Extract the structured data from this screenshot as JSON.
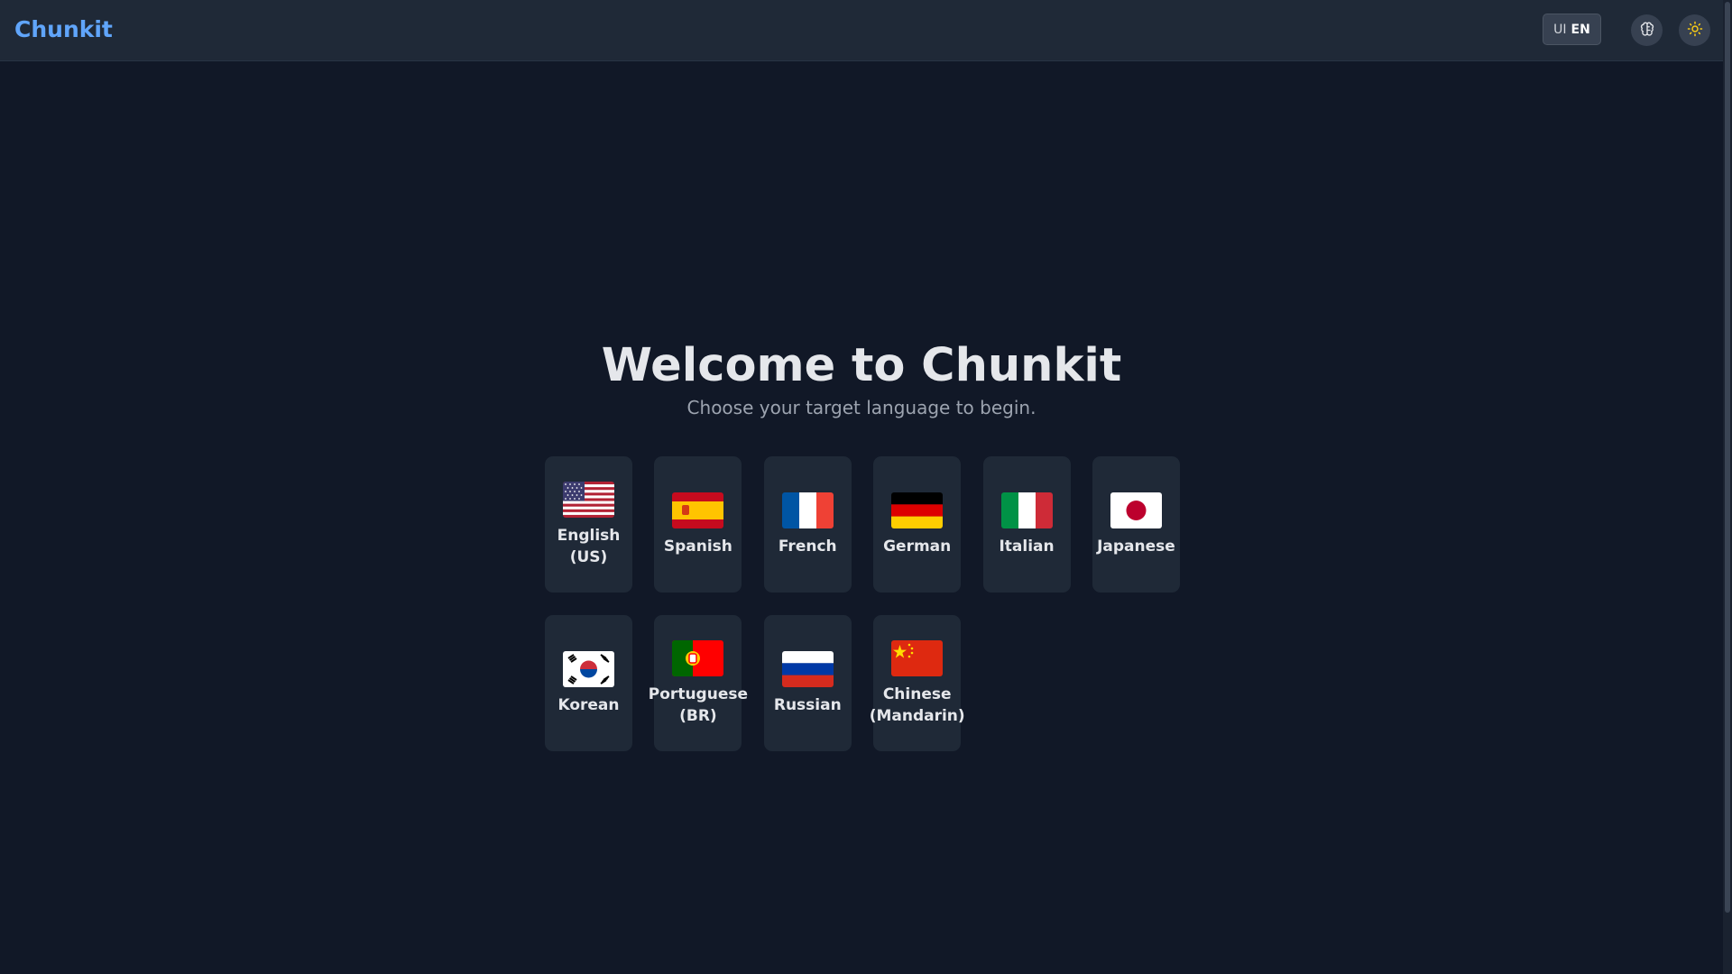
{
  "app": {
    "title": "Chunkit"
  },
  "header": {
    "ui_language_prefix": "UI",
    "ui_language_code": "EN",
    "settings_icon": "brain-icon",
    "theme_icon": "sun-icon",
    "accent_color": "#60a5fa",
    "sun_color": "#facc15"
  },
  "main": {
    "title": "Welcome to Chunkit",
    "subtitle": "Choose your target language to begin.",
    "languages": [
      {
        "label": "English\n(US)",
        "flag": "us-flag-icon"
      },
      {
        "label": "Spanish",
        "flag": "es-flag-icon"
      },
      {
        "label": "French",
        "flag": "fr-flag-icon"
      },
      {
        "label": "German",
        "flag": "de-flag-icon"
      },
      {
        "label": "Italian",
        "flag": "it-flag-icon"
      },
      {
        "label": "Japanese",
        "flag": "jp-flag-icon"
      },
      {
        "label": "Korean",
        "flag": "kr-flag-icon"
      },
      {
        "label": "Portuguese\n(BR)",
        "flag": "pt-flag-icon"
      },
      {
        "label": "Russian",
        "flag": "ru-flag-icon"
      },
      {
        "label": "Chinese\n(Mandarin)",
        "flag": "cn-flag-icon"
      }
    ]
  }
}
